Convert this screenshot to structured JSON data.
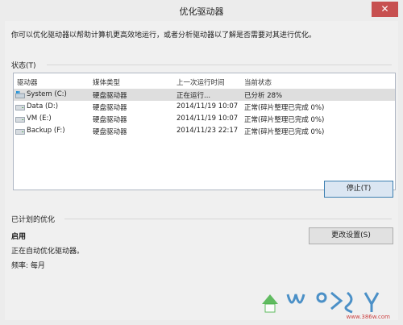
{
  "window": {
    "title": "优化驱动器",
    "close_glyph": "✕"
  },
  "description": "你可以优化驱动器以帮助计算机更高效地运行，或者分析驱动器以了解是否需要对其进行优化。",
  "status_section": {
    "label": "状态(T)",
    "columns": [
      "驱动器",
      "媒体类型",
      "上一次运行时间",
      "当前状态"
    ],
    "rows": [
      {
        "drive": "System (C:)",
        "media": "硬盘驱动器",
        "last_run": "正在运行...",
        "status": "已分析 28%",
        "selected": true,
        "icon": "windows-drive-icon"
      },
      {
        "drive": "Data (D:)",
        "media": "硬盘驱动器",
        "last_run": "2014/11/19 10:07",
        "status": "正常(碎片整理已完成 0%)",
        "selected": false,
        "icon": "hard-drive-icon"
      },
      {
        "drive": "VM (E:)",
        "media": "硬盘驱动器",
        "last_run": "2014/11/19 10:07",
        "status": "正常(碎片整理已完成 0%)",
        "selected": false,
        "icon": "hard-drive-icon"
      },
      {
        "drive": "Backup (F:)",
        "media": "硬盘驱动器",
        "last_run": "2014/11/23 22:17",
        "status": "正常(碎片整理已完成 0%)",
        "selected": false,
        "icon": "hard-drive-icon"
      }
    ],
    "stop_button": "停止(T)"
  },
  "schedule_section": {
    "label": "已计划的优化",
    "state": "启用",
    "detail": "正在自动优化驱动器。",
    "frequency": "频率: 每月",
    "change_button": "更改设置(S)"
  },
  "watermark": {
    "text": "www.386w.com"
  },
  "colors": {
    "close_button": "#c75050",
    "selected_row": "#dedede",
    "list_border": "#aeb6c3"
  }
}
